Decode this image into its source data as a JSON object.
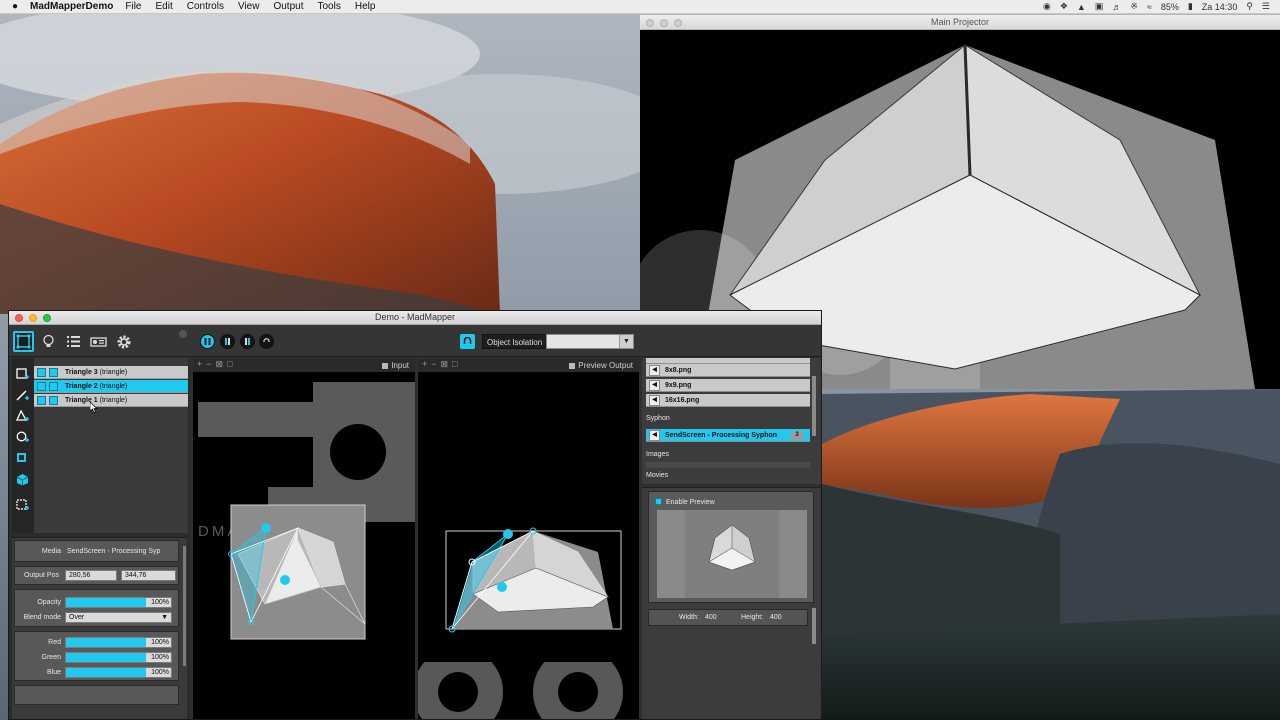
{
  "menubar": {
    "app_name": "MadMapperDemo",
    "menus": [
      "File",
      "Edit",
      "Controls",
      "View",
      "Output",
      "Tools",
      "Help"
    ],
    "battery": "85%",
    "clock": "Za 14:30"
  },
  "projector": {
    "title": "Main Projector"
  },
  "madmapper": {
    "title": "Demo - MadMapper",
    "object_isolation_label": "Object Isolation",
    "object_isolation_value": "",
    "layers": [
      {
        "name": "Triangle 3",
        "kind": "(triangle)",
        "selected": false
      },
      {
        "name": "Triangle 2",
        "kind": "(triangle)",
        "selected": true
      },
      {
        "name": "Triangle 1",
        "kind": "(triangle)",
        "selected": false
      }
    ],
    "props": {
      "media_label": "Media",
      "media_value": "SendScreen - Processing Syp",
      "output_pos_label": "Output Pos",
      "output_pos_x": "280,56",
      "output_pos_y": "344,76",
      "opacity_label": "Opacity",
      "opacity_value": "100%",
      "opacity_fraction": 1.0,
      "blend_label": "Blend mode",
      "blend_value": "Over",
      "red_label": "Red",
      "red_value": "100%",
      "green_label": "Green",
      "green_value": "100%",
      "blue_label": "Blue",
      "blue_value": "100%"
    },
    "input_view": {
      "label": "Input",
      "watermark": "DMAPPER"
    },
    "output_view": {
      "label": "Preview Output"
    },
    "media": {
      "files": [
        "8x8.png",
        "9x9.png",
        "16x16.png"
      ],
      "syphon_header": "Syphon",
      "syphon_item": "SendScreen - Processing Syphon",
      "syphon_badge": "3",
      "images_header": "Images",
      "movies_header": "Movies"
    },
    "preview": {
      "enable_label": "Enable Preview",
      "width_label": "Width:",
      "width_value": "400",
      "height_label": "Height:",
      "height_value": "400"
    }
  },
  "colors": {
    "accent": "#22c9ee"
  }
}
